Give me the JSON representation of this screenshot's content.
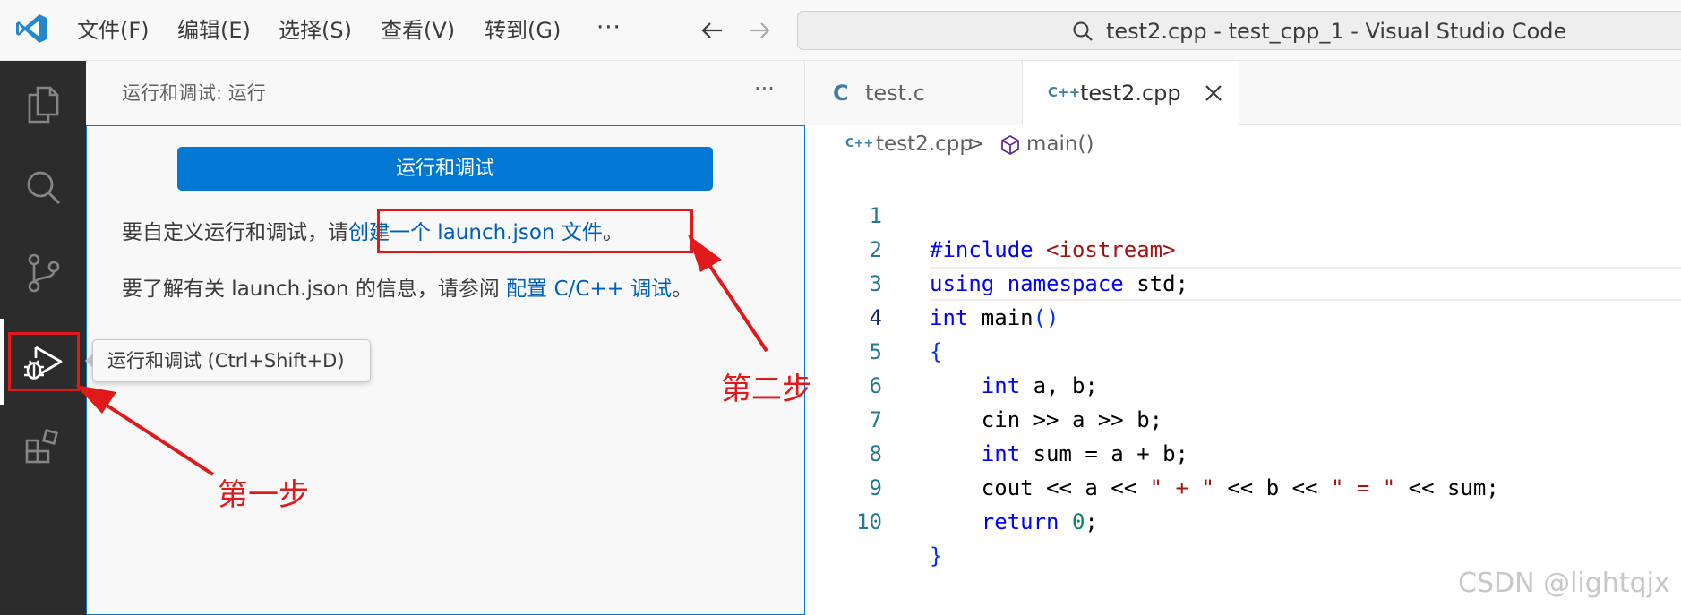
{
  "titlebar": {
    "menus": [
      "文件(F)",
      "编辑(E)",
      "选择(S)",
      "查看(V)",
      "转到(G)"
    ],
    "more": "···",
    "command_center": "test2.cpp - test_cpp_1 - Visual Studio Code"
  },
  "activity_bar": {
    "items": [
      "explorer-icon",
      "search-icon",
      "source-control-icon",
      "run-debug-icon",
      "extensions-icon"
    ],
    "active": "run-debug-icon"
  },
  "sidebar": {
    "title": "运行和调试: 运行",
    "more": "···",
    "run_button": "运行和调试",
    "para1_prefix": "要自定义运行和调试，请",
    "para1_link": "创建一个 launch.json 文件",
    "para1_suffix": "。",
    "para2_prefix": "要了解有关 launch.json 的信息，请参阅 ",
    "para2_link": "配置 C/C++ 调试",
    "para2_suffix": "。"
  },
  "tooltip": "运行和调试 (Ctrl+Shift+D)",
  "tabs": [
    {
      "icon": "C",
      "label": "test.c",
      "active": false
    },
    {
      "icon": "C++",
      "label": "test2.cpp",
      "active": true
    }
  ],
  "breadcrumb": {
    "file": "test2.cpp",
    "separator": ">",
    "symbol": "main()"
  },
  "editor": {
    "current_line": 4,
    "line_numbers": [
      "1",
      "2",
      "3",
      "4",
      "5",
      "6",
      "7",
      "8",
      "9",
      "10"
    ]
  },
  "annotations": {
    "step1": "第一步",
    "step2": "第二步"
  },
  "watermark": "CSDN @lightqjx",
  "colors": {
    "accent": "#0078d4",
    "link": "#005fb8",
    "annotation": "#e0191b",
    "activity_bar": "#2c2c2c"
  }
}
